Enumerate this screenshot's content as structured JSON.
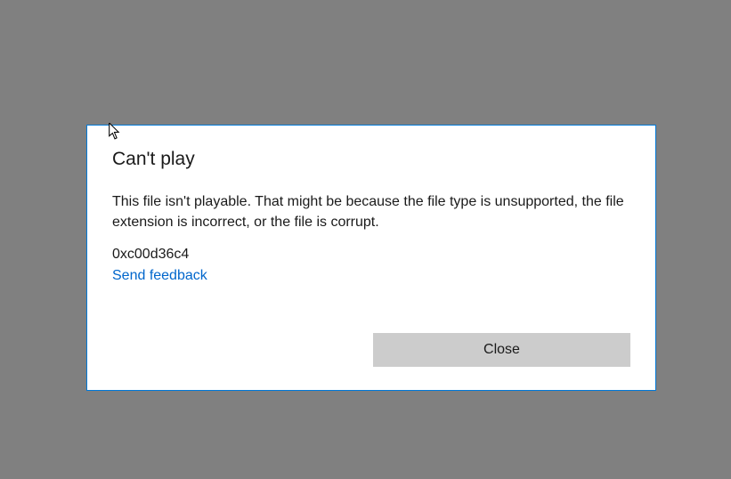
{
  "dialog": {
    "title": "Can't play",
    "message": "This file isn't playable. That might be because the file type is unsupported, the file extension is incorrect, or the file is corrupt.",
    "error_code": "0xc00d36c4",
    "feedback_link": "Send feedback",
    "close_button": "Close"
  }
}
